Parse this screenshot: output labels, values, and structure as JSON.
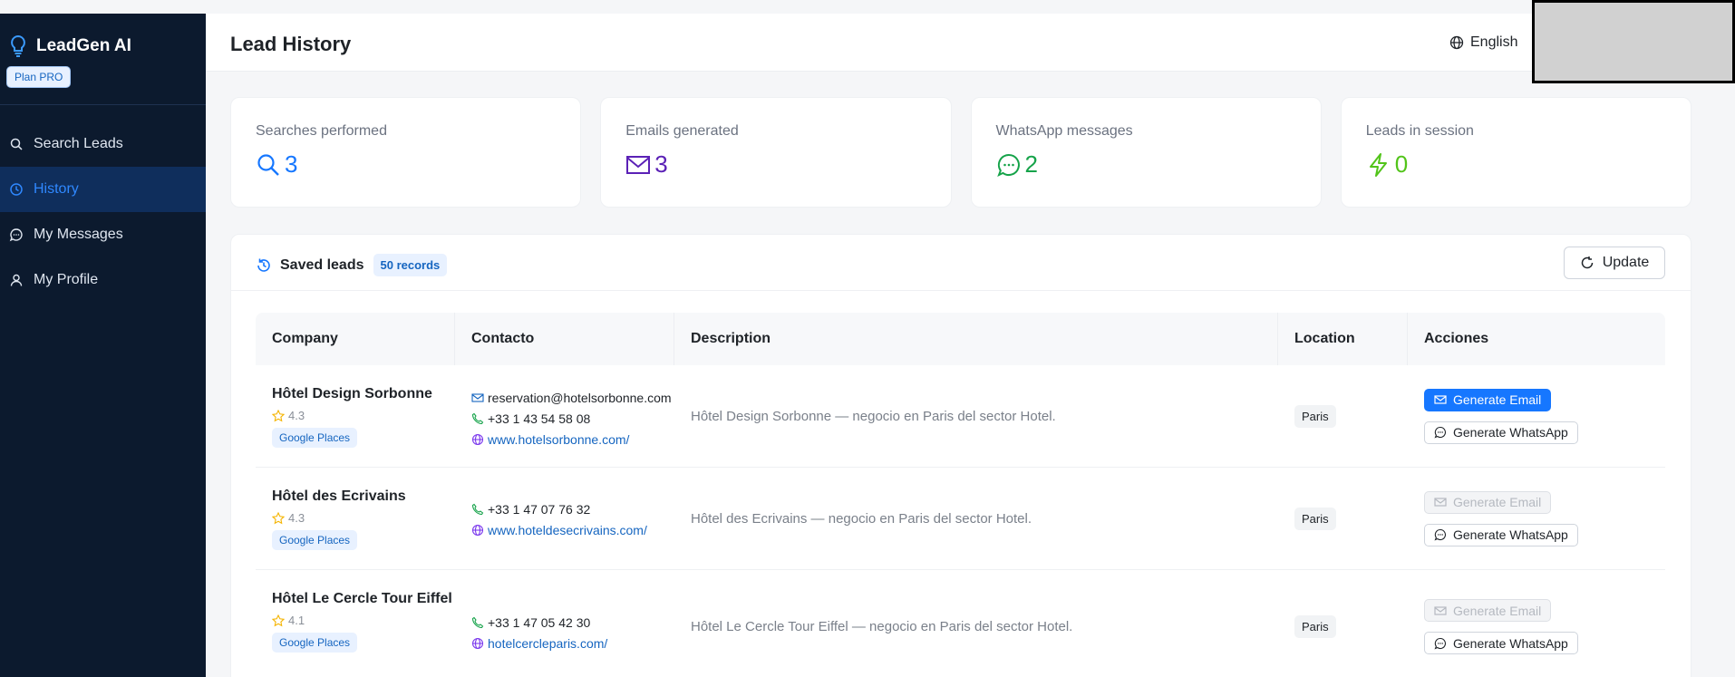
{
  "app": {
    "name": "LeadGen AI",
    "plan": "Plan PRO"
  },
  "colors": {
    "sidebar_bg": "#0c1a2e",
    "accent": "#1677ff",
    "active_nav": "#0f2e5c",
    "emails": "#5b21b6",
    "whatsapp": "#16a34a",
    "leads": "#52c41a"
  },
  "nav": [
    {
      "label": "Search Leads",
      "icon": "search-icon"
    },
    {
      "label": "History",
      "icon": "clock-icon",
      "active": true
    },
    {
      "label": "My Messages",
      "icon": "chat-bubble-icon"
    },
    {
      "label": "My Profile",
      "icon": "user-icon"
    }
  ],
  "header": {
    "title": "Lead History",
    "language": "English"
  },
  "stats": [
    {
      "label": "Searches performed",
      "value": "3",
      "icon": "search-icon"
    },
    {
      "label": "Emails generated",
      "value": "3",
      "icon": "mail-icon"
    },
    {
      "label": "WhatsApp messages",
      "value": "2",
      "icon": "chat-bubble-icon"
    },
    {
      "label": "Leads in session",
      "value": "0",
      "icon": "lightning-icon"
    }
  ],
  "panel": {
    "title": "Saved leads",
    "records": "50 records",
    "update_label": "Update"
  },
  "table": {
    "columns": [
      "Company",
      "Contacto",
      "Description",
      "Location",
      "Acciones"
    ],
    "rows": [
      {
        "company": "Hôtel Design Sorbonne",
        "rating": "4.3",
        "source": "Google Places",
        "email": "reservation@hotelsorbonne.com",
        "phone": "+33 1 43 54 58 08",
        "website": "www.hotelsorbonne.com/",
        "description": "Hôtel Design Sorbonne — negocio en Paris del sector Hotel.",
        "location": "Paris",
        "email_btn": "Generate Email",
        "email_enabled": true,
        "whatsapp_btn": "Generate WhatsApp"
      },
      {
        "company": "Hôtel des Ecrivains",
        "rating": "4.3",
        "source": "Google Places",
        "email": "",
        "phone": "+33 1 47 07 76 32",
        "website": "www.hoteldesecrivains.com/",
        "description": "Hôtel des Ecrivains — negocio en Paris del sector Hotel.",
        "location": "Paris",
        "email_btn": "Generate Email",
        "email_enabled": false,
        "whatsapp_btn": "Generate WhatsApp"
      },
      {
        "company": "Hôtel Le Cercle Tour Eiffel",
        "rating": "4.1",
        "source": "Google Places",
        "email": "",
        "phone": "+33 1 47 05 42 30",
        "website": "hotelcercleparis.com/",
        "description": "Hôtel Le Cercle Tour Eiffel — negocio en Paris del sector Hotel.",
        "location": "Paris",
        "email_btn": "Generate Email",
        "email_enabled": false,
        "whatsapp_btn": "Generate WhatsApp"
      }
    ]
  }
}
